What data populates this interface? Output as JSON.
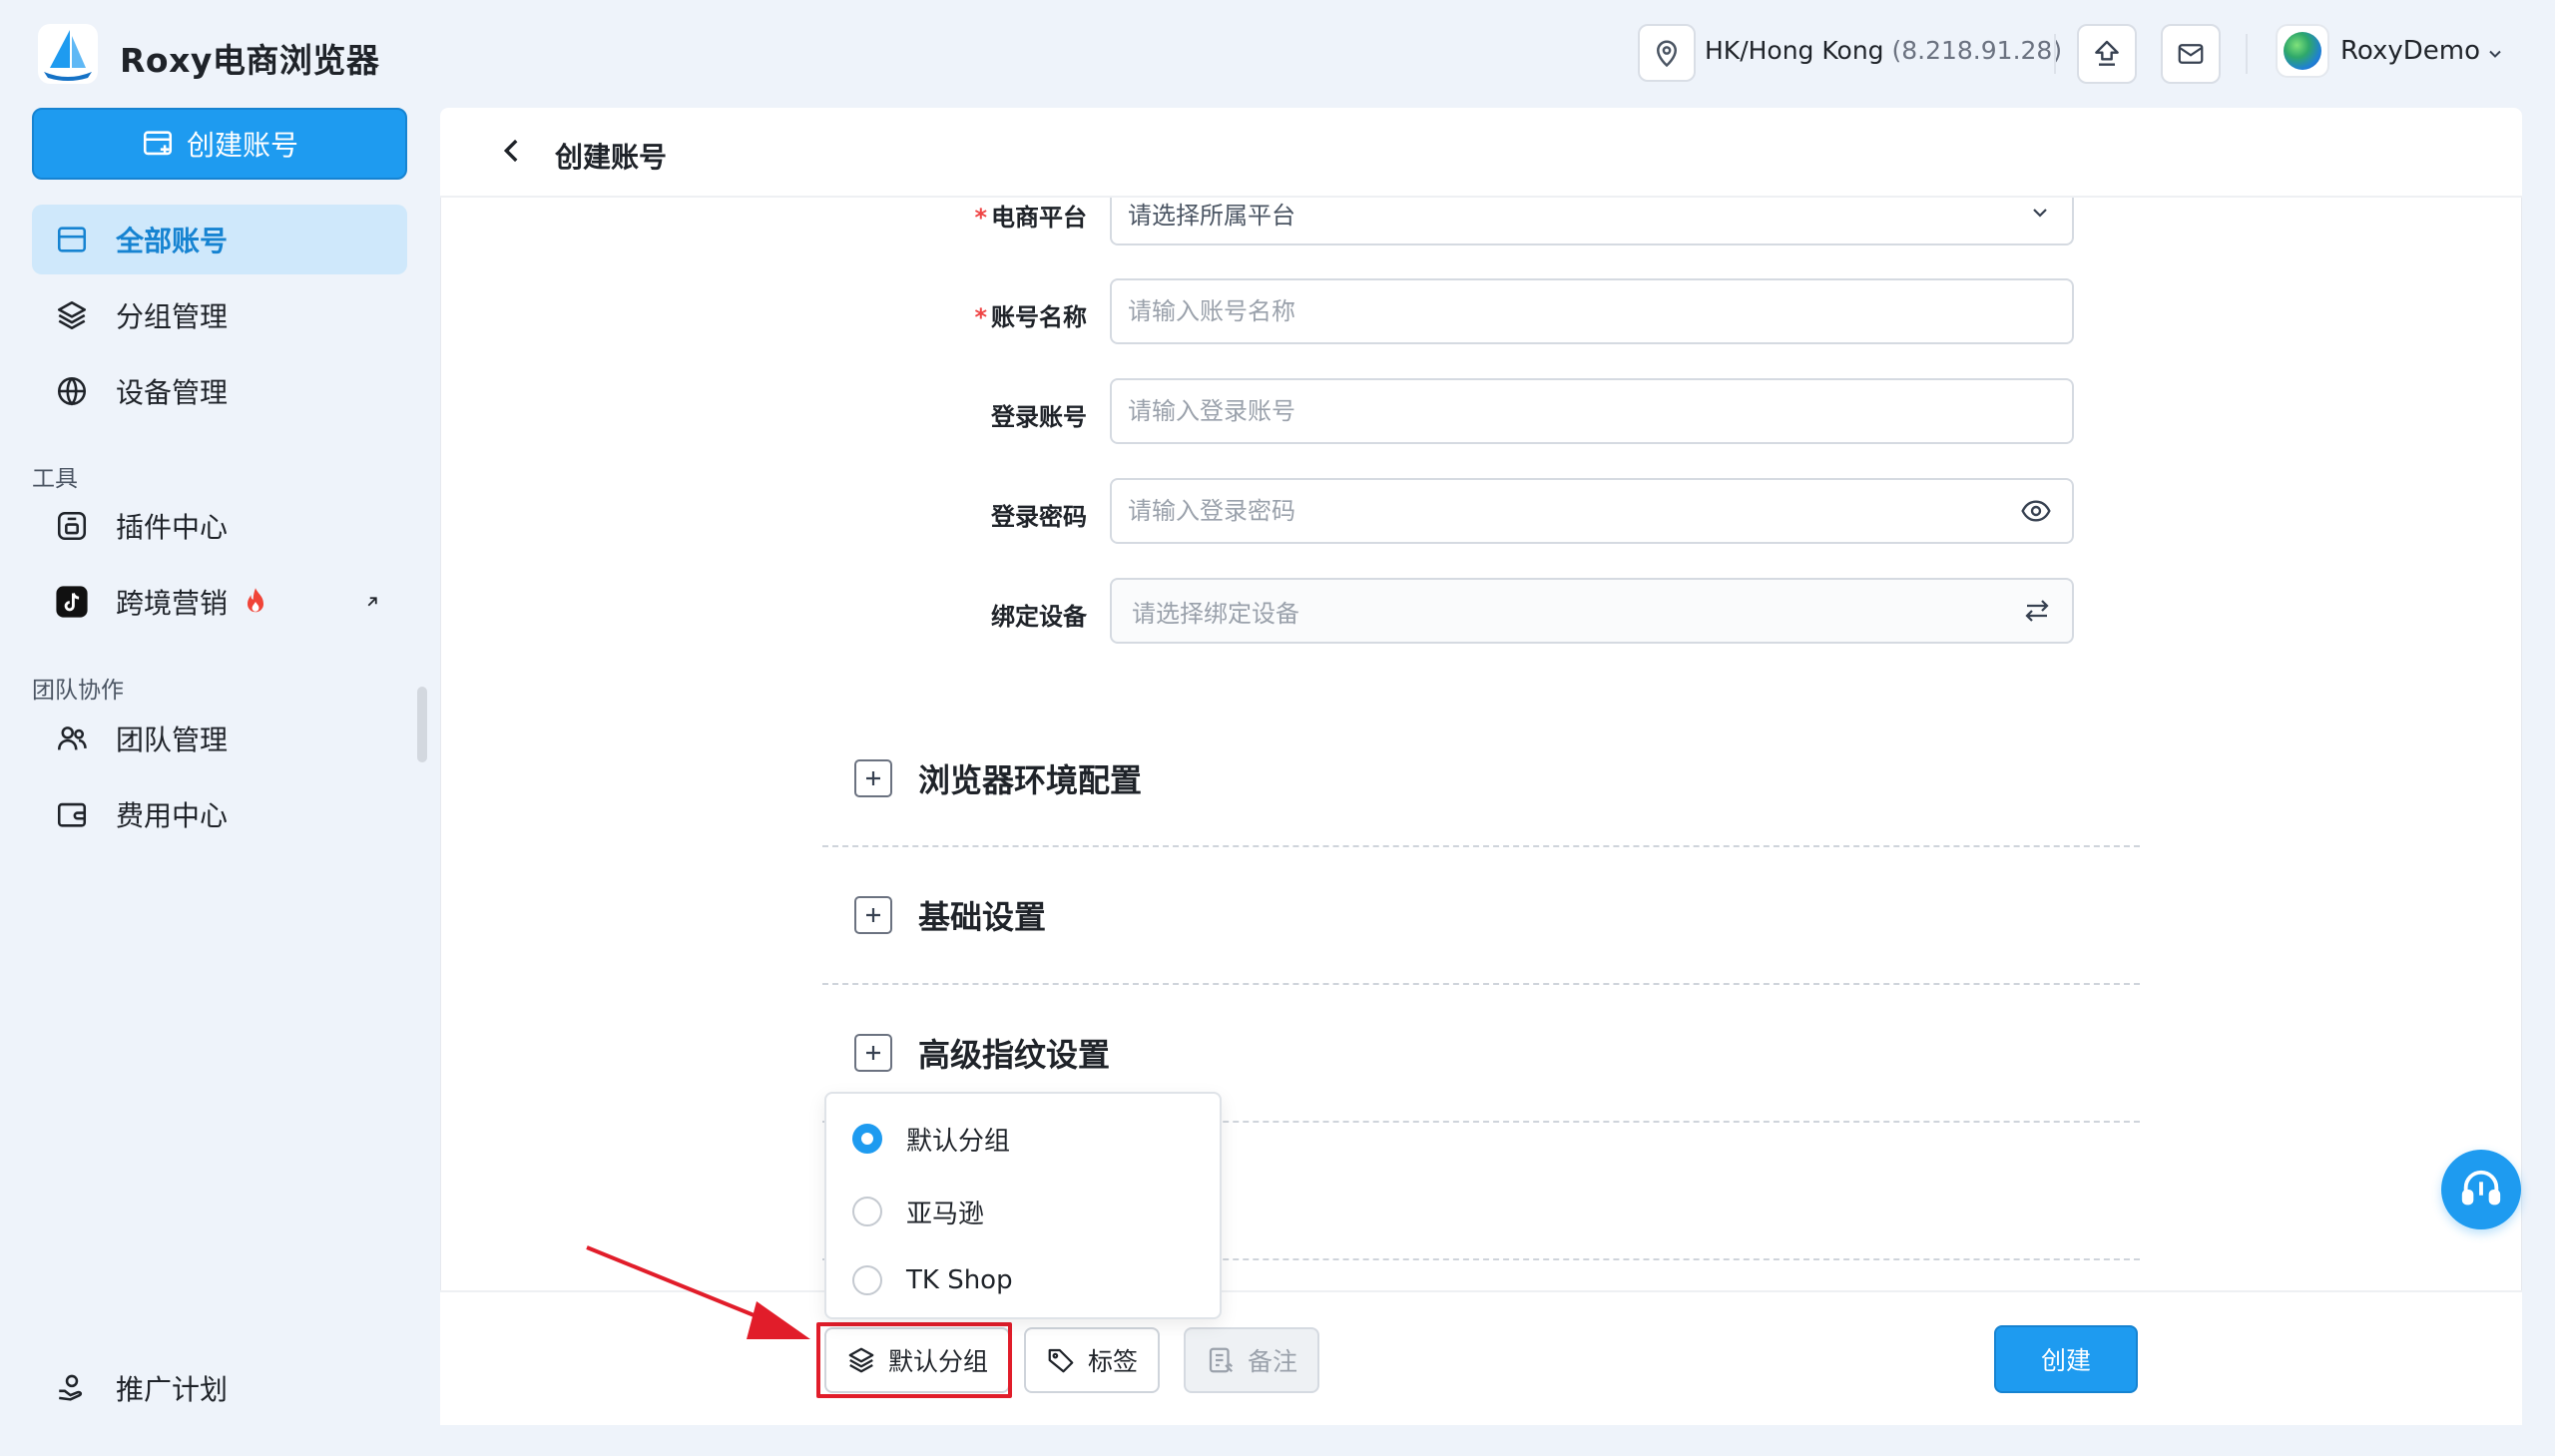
{
  "app": {
    "name": "Roxy电商浏览器"
  },
  "topbar": {
    "location": "HK/Hong Kong",
    "ip": "(8.218.91.28)",
    "user_name": "RoxyDemo"
  },
  "sidebar": {
    "create_button": "创建账号",
    "items": [
      {
        "label": "全部账号",
        "icon": "account-list-icon",
        "active": true
      },
      {
        "label": "分组管理",
        "icon": "layers-icon",
        "active": false
      },
      {
        "label": "设备管理",
        "icon": "globe-icon",
        "active": false
      }
    ],
    "tools_label": "工具",
    "tools": [
      {
        "label": "插件中心",
        "icon": "plugin-icon"
      },
      {
        "label": "跨境营销",
        "icon": "tiktok-icon"
      }
    ],
    "team_label": "团队协作",
    "team": [
      {
        "label": "团队管理",
        "icon": "team-icon"
      },
      {
        "label": "费用中心",
        "icon": "wallet-icon"
      }
    ],
    "promo": {
      "label": "推广计划",
      "icon": "promo-icon"
    }
  },
  "page": {
    "title": "创建账号"
  },
  "form": {
    "platform": {
      "label": "电商平台",
      "required": true,
      "placeholder": "请选择所属平台"
    },
    "account_name": {
      "label": "账号名称",
      "required": true,
      "placeholder": "请输入账号名称"
    },
    "login_account": {
      "label": "登录账号",
      "placeholder": "请输入登录账号"
    },
    "login_password": {
      "label": "登录密码",
      "placeholder": "请输入登录密码"
    },
    "bind_device": {
      "label": "绑定设备",
      "placeholder": "请选择绑定设备"
    }
  },
  "sections": [
    {
      "title": "浏览器环境配置"
    },
    {
      "title": "基础设置"
    },
    {
      "title": "高级指纹设置"
    }
  ],
  "group_dropdown": {
    "options": [
      {
        "label": "默认分组",
        "checked": true
      },
      {
        "label": "亚马逊",
        "checked": false
      },
      {
        "label": "TK Shop",
        "checked": false
      }
    ]
  },
  "bottom": {
    "group_chip": "默认分组",
    "tag_chip": "标签",
    "note_chip": "备注",
    "submit": "创建"
  },
  "colors": {
    "accent": "#1e9bf0",
    "highlight": "#e11d2a",
    "active_nav_bg": "#cfe8fb"
  }
}
